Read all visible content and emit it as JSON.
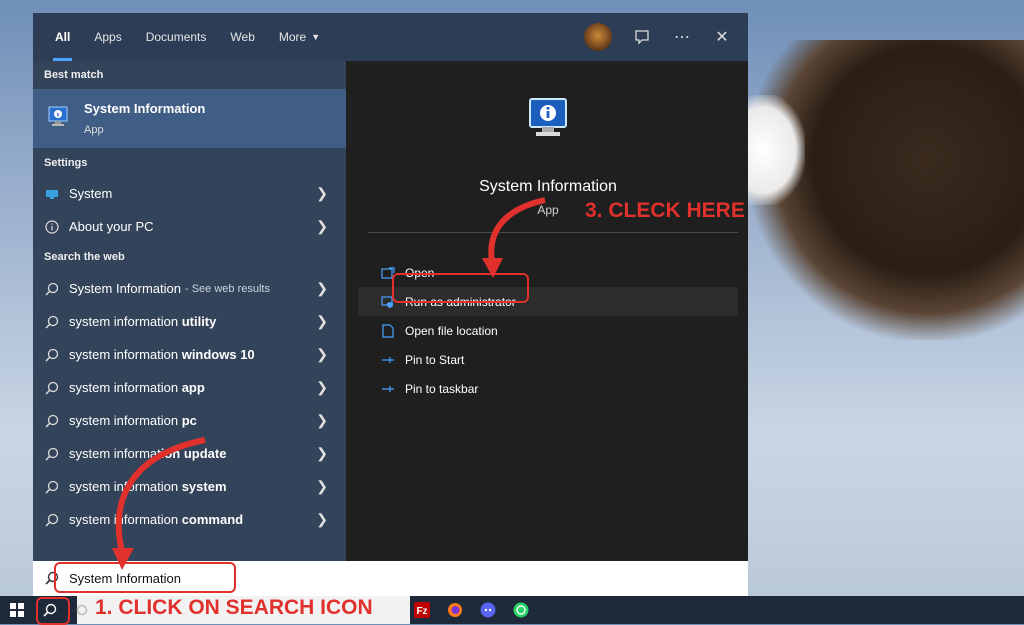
{
  "menu": {
    "tabs": [
      {
        "label": "All"
      },
      {
        "label": "Apps"
      },
      {
        "label": "Documents"
      },
      {
        "label": "Web"
      },
      {
        "label": "More"
      }
    ],
    "icons": [
      "avatar",
      "feedback-icon",
      "more-options-icon",
      "close-icon"
    ]
  },
  "left": {
    "best_match_header": "Best match",
    "best_match": {
      "title": "System Information",
      "subtitle": "App",
      "icon": "system-information-icon"
    },
    "settings_header": "Settings",
    "settings": [
      {
        "label": "System",
        "icon": "system-icon"
      },
      {
        "label": "About your PC",
        "icon": "info-icon"
      }
    ],
    "web_header": "Search the web",
    "web": [
      {
        "prefix": "System Information",
        "bold": "",
        "suffix": " - See web results"
      },
      {
        "prefix": "system information ",
        "bold": "utility",
        "suffix": ""
      },
      {
        "prefix": "system information ",
        "bold": "windows 10",
        "suffix": ""
      },
      {
        "prefix": "system information ",
        "bold": "app",
        "suffix": ""
      },
      {
        "prefix": "system information ",
        "bold": "pc",
        "suffix": ""
      },
      {
        "prefix": "system informat",
        "bold": "ion update",
        "suffix": ""
      },
      {
        "prefix": "system information ",
        "bold": "system",
        "suffix": ""
      },
      {
        "prefix": "system information ",
        "bold": "command",
        "suffix": ""
      }
    ]
  },
  "right": {
    "title": "System Information",
    "subtitle": "App",
    "actions": [
      {
        "label": "Open",
        "icon": "open-icon"
      },
      {
        "label": "Run as administrator",
        "icon": "admin-shield-icon"
      },
      {
        "label": "Open file location",
        "icon": "file-location-icon"
      },
      {
        "label": "Pin to Start",
        "icon": "pin-icon"
      },
      {
        "label": "Pin to taskbar",
        "icon": "pin-icon"
      }
    ]
  },
  "search": {
    "value": "System Information"
  },
  "taskbar": {
    "icons": [
      "windows-start-icon",
      "search-icon",
      "cortana-icon",
      "filezilla-icon",
      "firefox-icon",
      "discord-icon",
      "whatsapp-icon"
    ]
  },
  "annotations": {
    "step1": "1. CLICK ON SEARCH ICON",
    "step3": "3. CLECK HERE"
  },
  "colors": {
    "accent": "#4ba3ff",
    "annotation": "#e0312c",
    "highlight": "#3f5d85"
  }
}
